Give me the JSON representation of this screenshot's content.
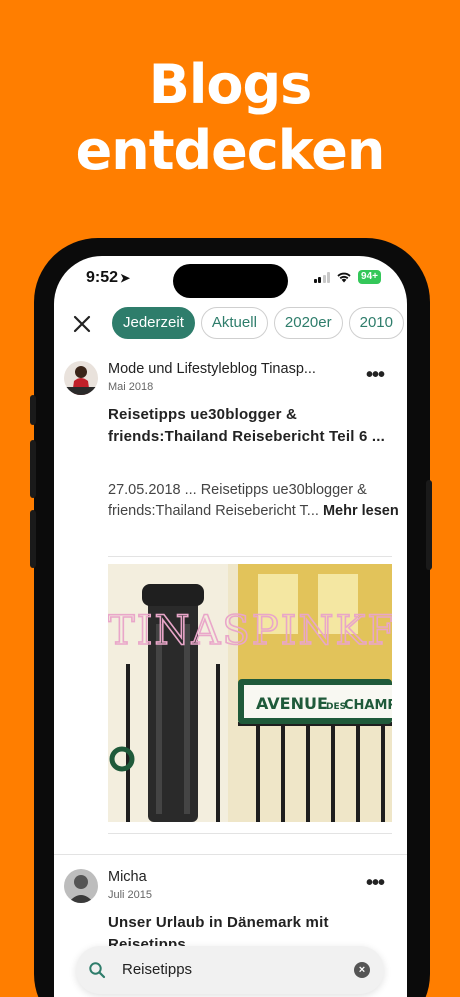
{
  "headline": {
    "line1": "Blogs",
    "line2": "entdecken"
  },
  "status_bar": {
    "time": "9:52",
    "location_glyph": "➤",
    "battery": "94+"
  },
  "filters": {
    "close_glyph": "✕",
    "chips": [
      "Jederzeit",
      "Aktuell",
      "2020er",
      "2010"
    ],
    "active_index": 0
  },
  "posts": [
    {
      "author": "Mode und Lifestyleblog Tinasp...",
      "date": "Mai 2018",
      "title": "Reisetipps ue30blogger & friends:Thailand Reisebericht Teil 6 ...",
      "excerpt": "27.05.2018 ... Reisetipps ue30blogger & friends:Thailand Reisebericht T...",
      "read_more": "Mehr lesen",
      "more_menu": "•••",
      "image": {
        "overlay_text": "TINASPINKFRI",
        "sign_text_main": "AVENUE",
        "sign_text_small": "DES",
        "sign_text_end": "CHAMPS-ÉLY"
      }
    },
    {
      "author": "Micha",
      "date": "Juli 2015",
      "title": "Unser Urlaub in Dänemark mit Reisetipps",
      "more_menu": "•••"
    }
  ],
  "search": {
    "value": "Reisetipps",
    "clear_glyph": "×"
  },
  "colors": {
    "background": "#FF7E00",
    "accent": "#2e7d6b",
    "battery": "#34C759"
  },
  "icons": [
    "location-arrow-icon",
    "signal-icon",
    "wifi-icon",
    "battery-icon",
    "close-icon",
    "more-icon",
    "search-icon",
    "clear-icon"
  ]
}
